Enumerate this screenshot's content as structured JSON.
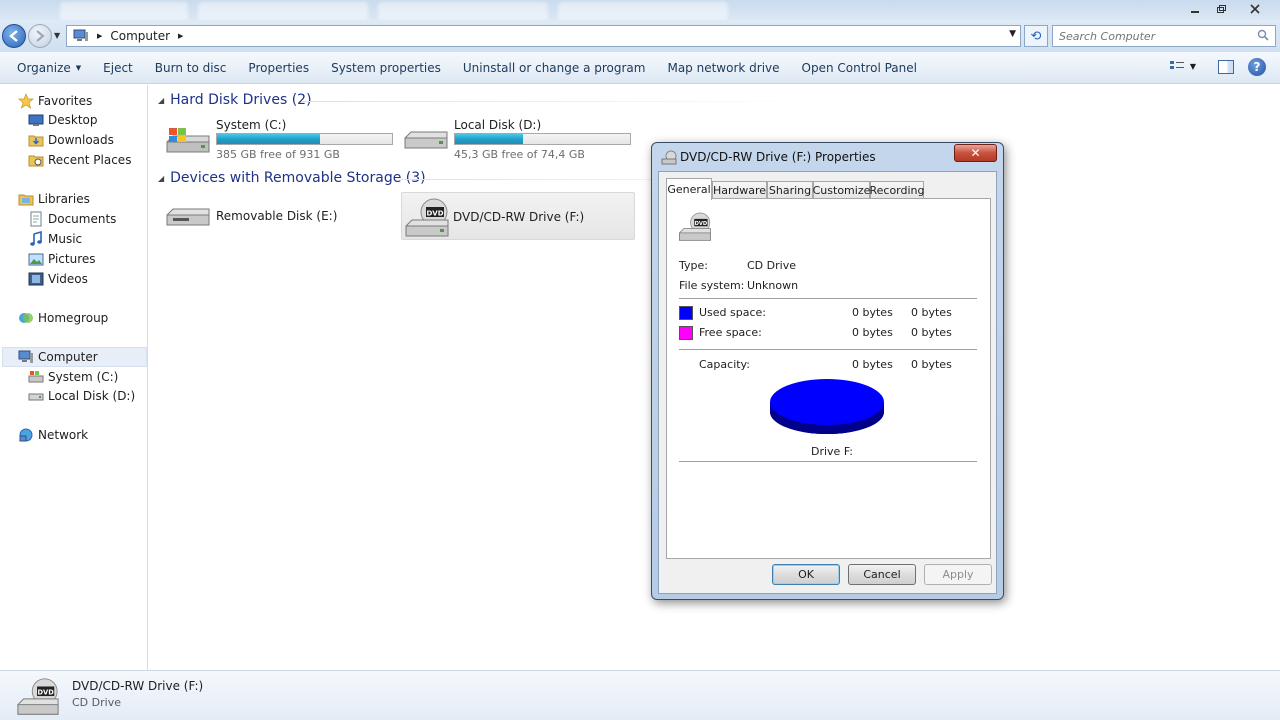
{
  "address_bar": {
    "crumb": "Computer",
    "search_placeholder": "Search Computer"
  },
  "toolbar": {
    "organize": "Organize",
    "eject": "Eject",
    "burn": "Burn to disc",
    "properties": "Properties",
    "system_properties": "System properties",
    "uninstall": "Uninstall or change a program",
    "map_drive": "Map network drive",
    "control_panel": "Open Control Panel"
  },
  "nav": {
    "favorites": "Favorites",
    "desktop": "Desktop",
    "downloads": "Downloads",
    "recent_places": "Recent Places",
    "libraries": "Libraries",
    "documents": "Documents",
    "music": "Music",
    "pictures": "Pictures",
    "videos": "Videos",
    "homegroup": "Homegroup",
    "computer": "Computer",
    "system_c": "System (C:)",
    "local_d": "Local Disk (D:)",
    "network": "Network"
  },
  "content": {
    "hdd_header": "Hard Disk Drives (2)",
    "removable_header": "Devices with Removable Storage (3)",
    "drives": [
      {
        "name": "System (C:)",
        "free_text": "385 GB free of 931 GB",
        "used_fraction": 0.59
      },
      {
        "name": "Local Disk (D:)",
        "free_text": "45,3 GB free of 74,4 GB",
        "used_fraction": 0.39
      }
    ],
    "removable": [
      {
        "name": "Removable Disk (E:)"
      },
      {
        "name": "DVD/CD-RW Drive (F:)"
      }
    ]
  },
  "details": {
    "name": "DVD/CD-RW Drive (F:)",
    "type": "CD Drive"
  },
  "dialog": {
    "title": "DVD/CD-RW Drive (F:) Properties",
    "close": "✕",
    "tabs": [
      "General",
      "Hardware",
      "Sharing",
      "Customize",
      "Recording"
    ],
    "type_label": "Type:",
    "type_value": "CD Drive",
    "fs_label": "File system:",
    "fs_value": "Unknown",
    "used_label": "Used space:",
    "used_bytes": "0 bytes",
    "used_bytes2": "0 bytes",
    "free_label": "Free space:",
    "free_bytes": "0 bytes",
    "free_bytes2": "0 bytes",
    "capacity_label": "Capacity:",
    "capacity_bytes": "0 bytes",
    "capacity_bytes2": "0 bytes",
    "drive_label": "Drive F:",
    "used_color": "#0000ff",
    "free_color": "#ff00ff",
    "ok": "OK",
    "cancel": "Cancel",
    "apply": "Apply"
  }
}
